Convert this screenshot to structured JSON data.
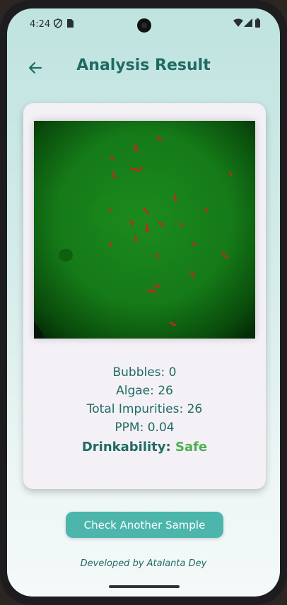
{
  "status_bar": {
    "time": "4:24"
  },
  "app_bar": {
    "title": "Analysis Result"
  },
  "result": {
    "bubbles": "Bubbles: 0",
    "algae": "Algae: 26",
    "total_impurities": "Total Impurities: 26",
    "ppm": "PPM: 0.04",
    "drinkability_label": "Drinkability:",
    "drinkability_value": "Safe"
  },
  "actions": {
    "check_another": "Check Another Sample"
  },
  "footer": {
    "credit": "Developed by Atalanta Dey"
  },
  "colors": {
    "accent": "#1f6b62",
    "button": "#4db6ac",
    "safe": "#4caf50"
  }
}
